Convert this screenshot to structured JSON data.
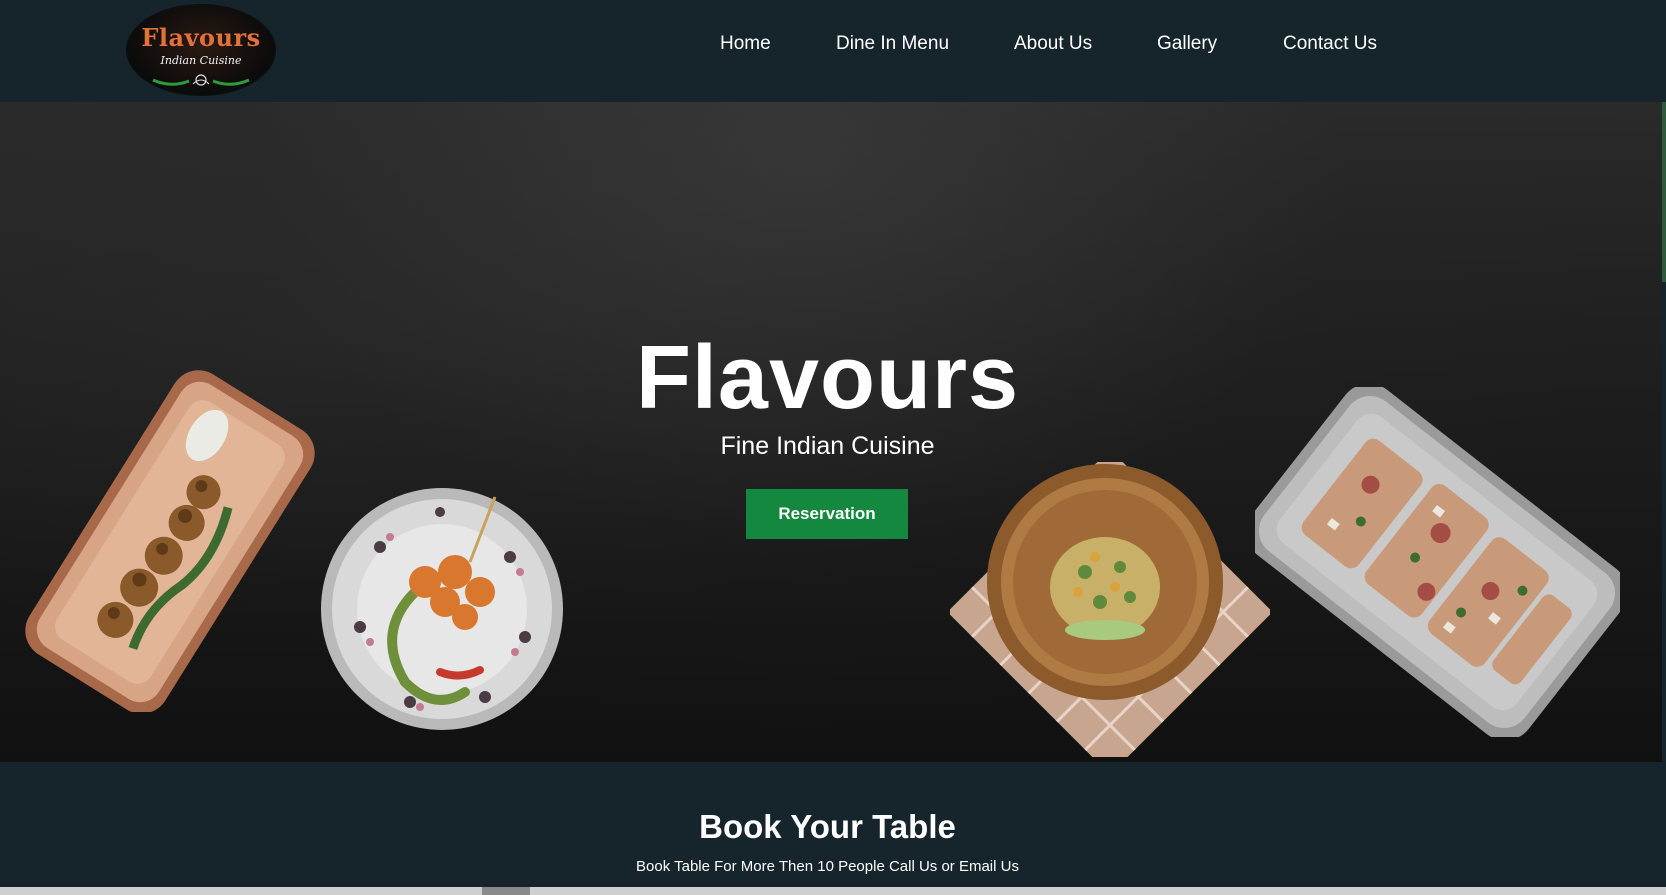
{
  "header": {
    "logo": {
      "title": "Flavours",
      "subtitle": "Indian Cuisine"
    },
    "nav": [
      {
        "label": "Home"
      },
      {
        "label": "Dine In Menu"
      },
      {
        "label": "About Us"
      },
      {
        "label": "Gallery"
      },
      {
        "label": "Contact Us"
      }
    ]
  },
  "hero": {
    "title": "Flavours",
    "subtitle": "Fine Indian Cuisine",
    "button_label": "Reservation"
  },
  "booking": {
    "title": "Book Your Table",
    "subtitle": "Book Table For More Then 10 People Call Us or Email Us"
  },
  "colors": {
    "header_bg": "#16242c",
    "button_green": "#14883e",
    "logo_orange": "#e2713a"
  }
}
